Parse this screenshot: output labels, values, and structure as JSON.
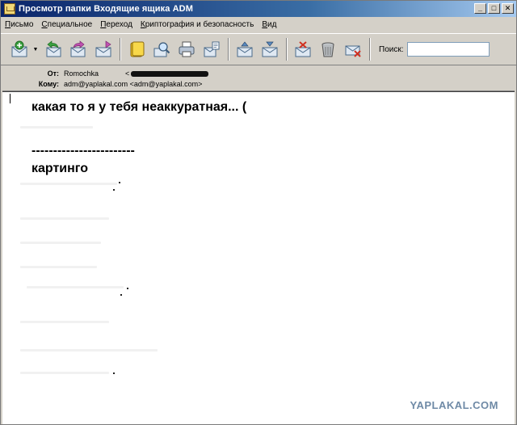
{
  "window": {
    "title": "Просмотр папки Входящие ящика ADM",
    "buttons": {
      "minimize": "_",
      "maximize": "□",
      "close": "✕"
    }
  },
  "menu": [
    {
      "first": "П",
      "rest": "исьмо"
    },
    {
      "first": "С",
      "rest": "пециальное"
    },
    {
      "first": "П",
      "rest": "ереход"
    },
    {
      "first": "К",
      "rest": "риптография и безопасность"
    },
    {
      "first": "В",
      "rest": "ид"
    }
  ],
  "toolbar": {
    "icons": [
      "new-mail-icon",
      "reply-icon",
      "forward-icon",
      "send-receive-icon",
      "notes-icon",
      "search-mail-icon",
      "print-icon",
      "compose-icon",
      "move-up-icon",
      "move-down-icon",
      "delete-mark-icon",
      "trash-icon",
      "block-icon"
    ],
    "search_label": "Поиск:",
    "search_value": ""
  },
  "headers": {
    "from_label": "От:",
    "from_name": "Romochka",
    "from_addr_open": "<",
    "to_label": "Кому:",
    "to_value": "adm@yaplakal.com <adm@yaplakal.com>"
  },
  "body": {
    "line1": "какая то я у тебя неаккуратная... (",
    "divider": "------------------------",
    "signature": "картинго"
  },
  "watermark": "YAPLAKAL.COM",
  "colors": {
    "title_gradient_start": "#0a246a",
    "title_gradient_end": "#a6caf0",
    "chrome": "#d4d0c8",
    "watermark": "#6f8aa6"
  }
}
